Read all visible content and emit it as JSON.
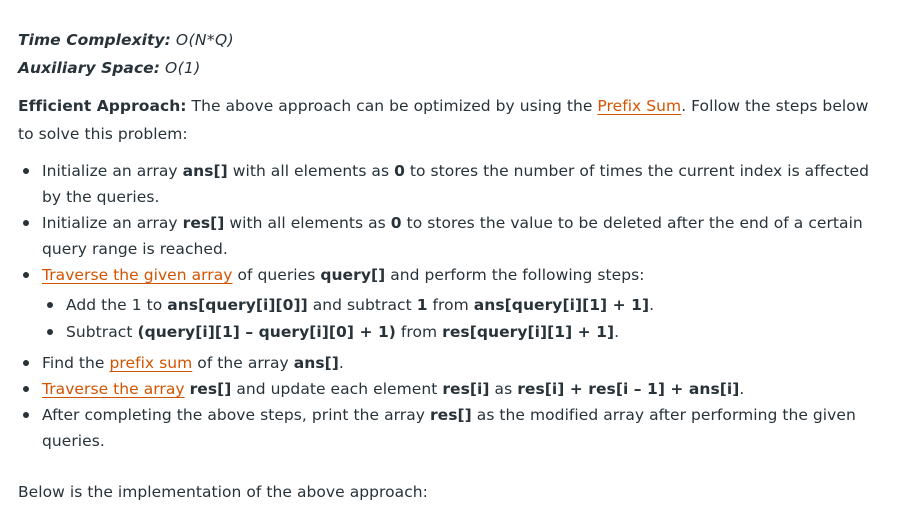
{
  "complexity": {
    "time_label": "Time Complexity:",
    "time_value": "O(N*Q)",
    "space_label": "Auxiliary Space:",
    "space_value": "O(1)"
  },
  "approach": {
    "label": "Efficient Approach:",
    "text_before_link": "The above approach can be optimized by using the",
    "link": "Prefix Sum",
    "text_after_link": ". Follow the steps below",
    "line2": "to solve this problem:"
  },
  "steps": {
    "s1": {
      "a": "Initialize an array",
      "b1": "ans[]",
      "c": "with all elements as",
      "b2": "0",
      "d": "to stores the number of times the current index is affected",
      "cont": "by the queries."
    },
    "s2": {
      "a": "Initialize an array",
      "b1": "res[]",
      "c": "with all elements as",
      "b2": "0",
      "d": "to stores the value to be deleted after the end of a certain",
      "cont": "query range is reached."
    },
    "s3": {
      "link": "Traverse the given array",
      "a": "of queries",
      "b1": "query[]",
      "c": "and perform the following steps:"
    },
    "sub1": {
      "a": "Add the 1 to",
      "b1": "ans[query[i][0]]",
      "c": "and subtract",
      "b2": "1",
      "d": "from",
      "b3": "ans[query[i][1] + 1]",
      "e": "."
    },
    "sub2": {
      "a": "Subtract",
      "b1": "(query[i][1] – query[i][0] + 1)",
      "c": "from",
      "b2": "res[query[i][1] + 1]",
      "d": "."
    },
    "s4": {
      "a": "Find the",
      "link": "prefix sum",
      "b": "of the array",
      "b1": "ans[]",
      "c": "."
    },
    "s5": {
      "link": "Traverse the array",
      "b1": "res[]",
      "a": "and update each element",
      "b2": "res[i]",
      "c": "as",
      "b3": "res[i] + res[i – 1] + ans[i]",
      "d": "."
    },
    "s6": {
      "a": "After completing the above steps, print the array",
      "b1": "res[]",
      "b": "as the modified array after performing the given",
      "cont": "queries."
    }
  },
  "footer": {
    "text": "Below is the implementation of the above approach:"
  }
}
